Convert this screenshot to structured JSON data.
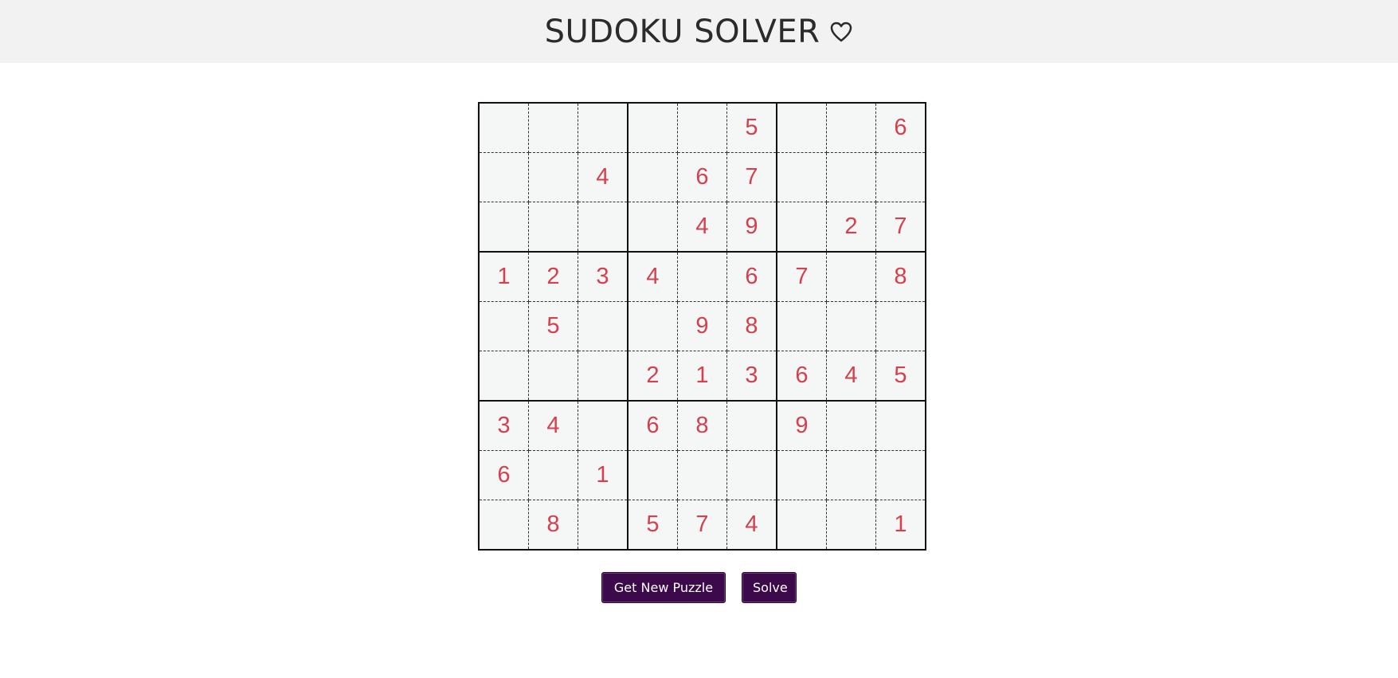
{
  "header": {
    "title": "SUDOKU SOLVER",
    "icon": "heart-icon"
  },
  "board": {
    "rows": [
      [
        "",
        "",
        "",
        "",
        "",
        "5",
        "",
        "",
        "6"
      ],
      [
        "",
        "",
        "4",
        "",
        "6",
        "7",
        "",
        "",
        ""
      ],
      [
        "",
        "",
        "",
        "",
        "4",
        "9",
        "",
        "2",
        "7"
      ],
      [
        "1",
        "2",
        "3",
        "4",
        "",
        "6",
        "7",
        "",
        "8"
      ],
      [
        "",
        "5",
        "",
        "",
        "9",
        "8",
        "",
        "",
        ""
      ],
      [
        "",
        "",
        "",
        "2",
        "1",
        "3",
        "6",
        "4",
        "5"
      ],
      [
        "3",
        "4",
        "",
        "6",
        "8",
        "",
        "9",
        "",
        ""
      ],
      [
        "6",
        "",
        "1",
        "",
        "",
        "",
        "",
        "",
        ""
      ],
      [
        "",
        "8",
        "",
        "5",
        "7",
        "4",
        "",
        "",
        "1"
      ]
    ],
    "digit_color": "#d4404d"
  },
  "buttons": {
    "new_puzzle_label": "Get New Puzzle",
    "solve_label": "Solve",
    "button_color": "#3c0a4a"
  }
}
